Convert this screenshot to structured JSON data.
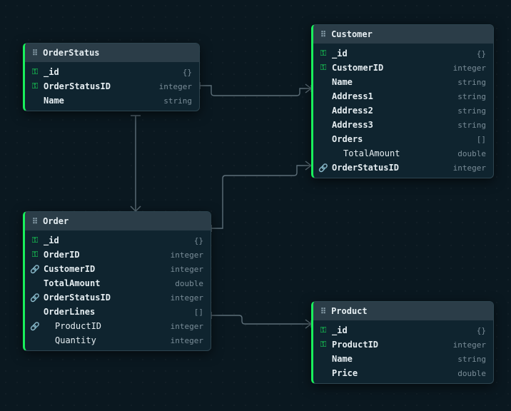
{
  "entities": {
    "orderStatus": {
      "title": "OrderStatus",
      "fields": [
        {
          "name": "_id",
          "type": "{}",
          "icon": "key"
        },
        {
          "name": "OrderStatusID",
          "type": "integer",
          "icon": "key"
        },
        {
          "name": "Name",
          "type": "string",
          "icon": null
        }
      ]
    },
    "customer": {
      "title": "Customer",
      "fields": [
        {
          "name": "_id",
          "type": "{}",
          "icon": "key"
        },
        {
          "name": "CustomerID",
          "type": "integer",
          "icon": "key"
        },
        {
          "name": "Name",
          "type": "string",
          "icon": null
        },
        {
          "name": "Address1",
          "type": "string",
          "icon": null
        },
        {
          "name": "Address2",
          "type": "string",
          "icon": null
        },
        {
          "name": "Address3",
          "type": "string",
          "icon": null
        },
        {
          "name": "Orders",
          "type": "[]",
          "icon": null
        },
        {
          "name": "TotalAmount",
          "type": "double",
          "icon": null,
          "nested": true
        },
        {
          "name": "OrderStatusID",
          "type": "integer",
          "icon": "link"
        }
      ]
    },
    "order": {
      "title": "Order",
      "fields": [
        {
          "name": "_id",
          "type": "{}",
          "icon": "key"
        },
        {
          "name": "OrderID",
          "type": "integer",
          "icon": "key"
        },
        {
          "name": "CustomerID",
          "type": "integer",
          "icon": "link"
        },
        {
          "name": "TotalAmount",
          "type": "double",
          "icon": null
        },
        {
          "name": "OrderStatusID",
          "type": "integer",
          "icon": "link"
        },
        {
          "name": "OrderLines",
          "type": "[]",
          "icon": null
        },
        {
          "name": "ProductID",
          "type": "integer",
          "icon": "link",
          "nested": true
        },
        {
          "name": "Quantity",
          "type": "integer",
          "icon": null,
          "nested": true
        }
      ]
    },
    "product": {
      "title": "Product",
      "fields": [
        {
          "name": "_id",
          "type": "{}",
          "icon": "key"
        },
        {
          "name": "ProductID",
          "type": "integer",
          "icon": "key"
        },
        {
          "name": "Name",
          "type": "string",
          "icon": null
        },
        {
          "name": "Price",
          "type": "double",
          "icon": null
        }
      ]
    }
  },
  "colors": {
    "accent": "#19ef5c",
    "bg": "#0a1820",
    "panel": "#0f242f",
    "header": "#2b3d48",
    "typeText": "#7a8d98"
  }
}
